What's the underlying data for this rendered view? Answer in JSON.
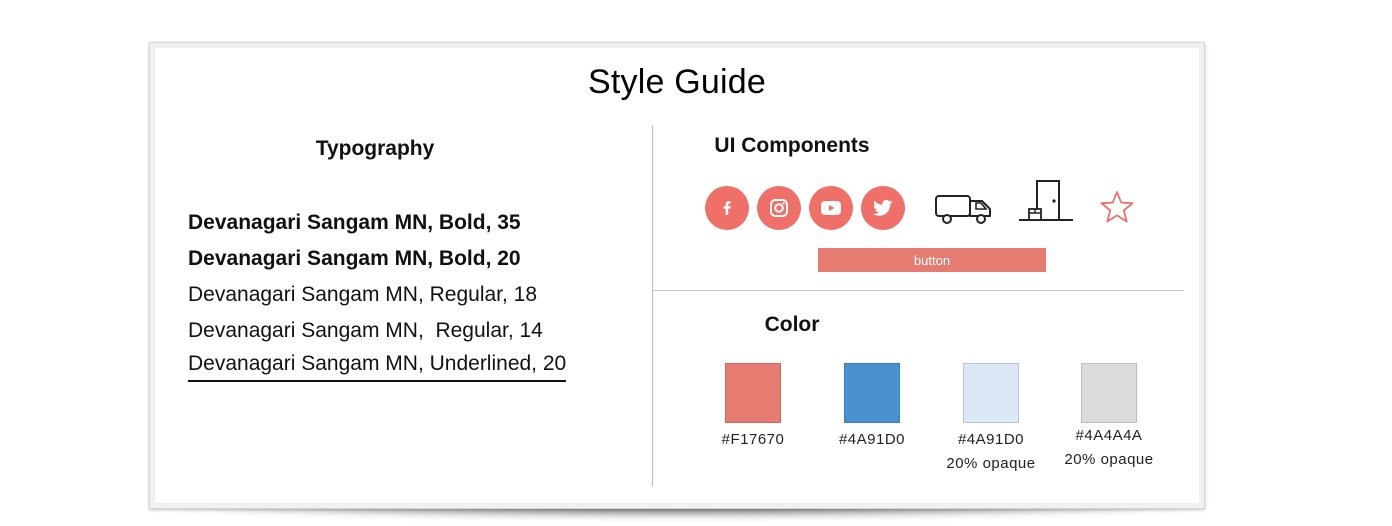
{
  "title": "Style Guide",
  "typography": {
    "heading": "Typography",
    "lines": [
      {
        "text": "Devanagari Sangam MN, Bold, 35",
        "style": "bold"
      },
      {
        "text": "Devanagari Sangam MN, Bold, 20",
        "style": "bold"
      },
      {
        "text": "Devanagari Sangam MN, Regular, 18",
        "style": "regular"
      },
      {
        "text": "Devanagari Sangam MN,  Regular, 14",
        "style": "regular"
      },
      {
        "text": "Devanagari Sangam MN, Underlined, 20",
        "style": "underlined"
      }
    ]
  },
  "ui_components": {
    "heading": "UI Components",
    "icons": [
      "facebook-icon",
      "instagram-icon",
      "youtube-icon",
      "twitter-icon",
      "delivery-truck-icon",
      "door-delivery-icon",
      "star-icon"
    ],
    "button_label": "button",
    "accent_color": "#F17670"
  },
  "color": {
    "heading": "Color",
    "swatches": [
      {
        "hex": "#F17670",
        "caption": "#F17670",
        "note": "",
        "fill": "#e57b71"
      },
      {
        "hex": "#4A91D0",
        "caption": "#4A91D0",
        "note": "",
        "fill": "#4a91d0"
      },
      {
        "hex": "#4A91D0",
        "caption": "#4A91D0",
        "note": "20% opaque",
        "fill": "#dbe9f6"
      },
      {
        "hex": "#4A4A4A",
        "caption": "#4A4A4A",
        "note": "20% opaque",
        "fill": "#dbdbdb"
      }
    ]
  }
}
